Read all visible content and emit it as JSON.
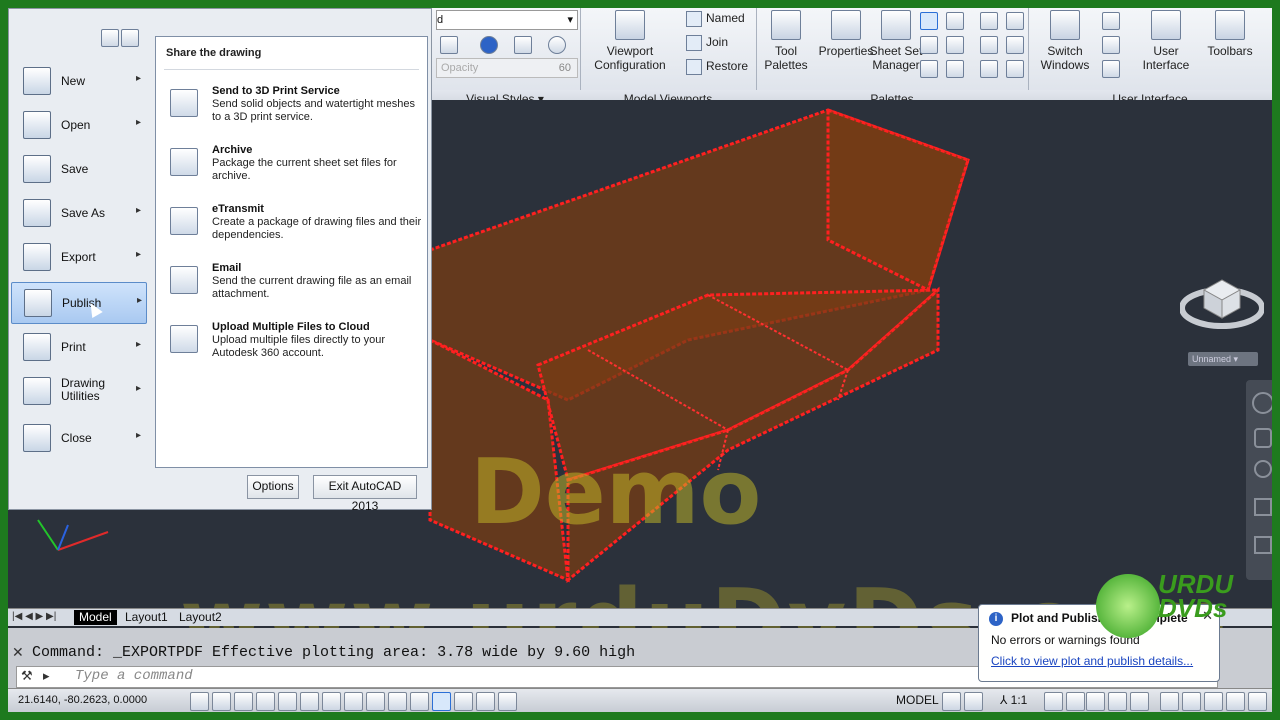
{
  "ribbon": {
    "combo_text": "d",
    "opacity_value": "60",
    "opacity_label": "Opacity",
    "visual_styles_title": "Visual Styles",
    "viewport_config": "Viewport\nConfiguration",
    "named": "Named",
    "join": "Join",
    "restore": "Restore",
    "model_viewports_title": "Model Viewports",
    "tool_palettes": "Tool\nPalettes",
    "properties": "Properties",
    "sheet_set_manager": "Sheet Set\nManager",
    "palettes_title": "Palettes",
    "switch_windows": "Switch\nWindows",
    "user_interface_btn": "User\nInterface",
    "toolbars": "Toolbars",
    "user_interface_title": "User Interface"
  },
  "appmenu": {
    "items": [
      {
        "label": "New"
      },
      {
        "label": "Open"
      },
      {
        "label": "Save"
      },
      {
        "label": "Save As"
      },
      {
        "label": "Export"
      },
      {
        "label": "Publish"
      },
      {
        "label": "Print"
      },
      {
        "label": "Drawing\nUtilities"
      },
      {
        "label": "Close"
      }
    ],
    "share_heading": "Share the drawing",
    "share_items": [
      {
        "title": "Send to 3D Print Service",
        "desc": "Send solid objects and watertight meshes to a 3D print service."
      },
      {
        "title": "Archive",
        "desc": "Package the current sheet set files for archive."
      },
      {
        "title": "eTransmit",
        "desc": "Create a package of drawing files and their dependencies."
      },
      {
        "title": "Email",
        "desc": "Send the current drawing file as an email attachment."
      },
      {
        "title": "Upload Multiple Files to Cloud",
        "desc": "Upload multiple files directly to your Autodesk 360 account."
      }
    ],
    "options_button": "Options",
    "exit_button": "Exit AutoCAD 2013"
  },
  "viewport": {
    "viewcube_label": "Unnamed",
    "watermark_demo": "Demo",
    "watermark_url": "www.urduDvDs.com",
    "logo_text": "URDU\nDVDs"
  },
  "tabs": [
    "Model",
    "Layout1",
    "Layout2"
  ],
  "command": {
    "history": "Command:  _EXPORTPDF Effective plotting area:  3.78 wide by 9.60 high",
    "placeholder": "Type a command"
  },
  "status": {
    "coords": "21.6140, -80.2623, 0.0000",
    "model": "MODEL",
    "scale": "1:1"
  },
  "notification": {
    "title": "Plot and Publish Job Complete",
    "message": "No errors or warnings found",
    "link": "Click to view plot and publish details..."
  }
}
